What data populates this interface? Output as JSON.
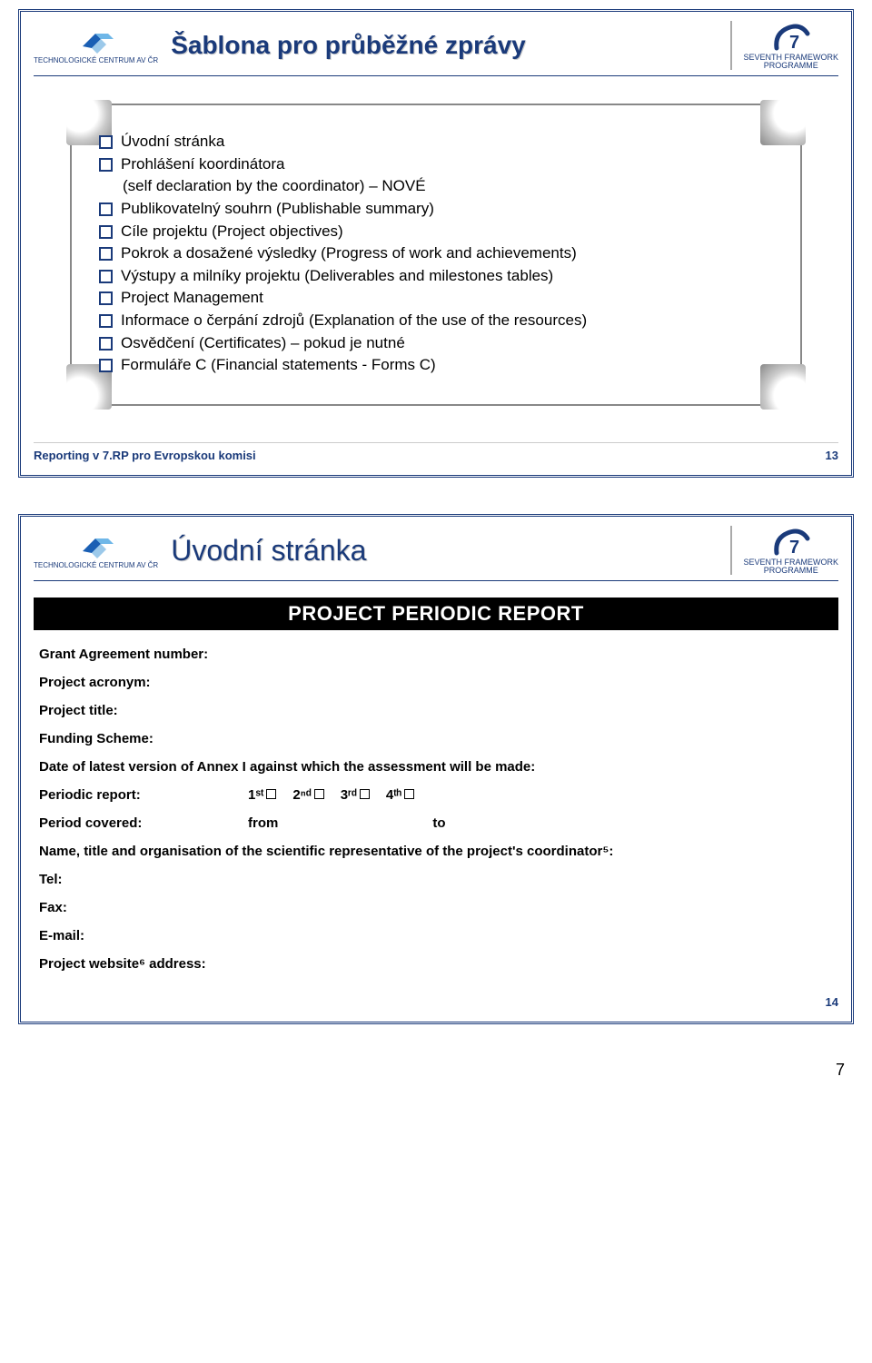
{
  "slide1": {
    "title": "Šablona pro průběžné zprávy",
    "logo_tc_line": "TECHNOLOGICKÉ CENTRUM AV ČR",
    "logo_fp7_line1": "SEVENTH FRAMEWORK",
    "logo_fp7_line2": "PROGRAMME",
    "bullets": [
      "Úvodní stránka",
      "Prohlášení koordinátora",
      "(self declaration by the coordinator) – NOVÉ",
      "Publikovatelný souhrn (Publishable summary)",
      "Cíle projektu (Project objectives)",
      "Pokrok a dosažené výsledky (Progress of work and achievements)",
      "Výstupy a milníky projektu (Deliverables and milestones tables)",
      "Project Management",
      "Informace o čerpání zdrojů (Explanation of the use of the resources)",
      "Osvědčení (Certificates) – pokud je nutné",
      "Formuláře C (Financial statements - Forms C)"
    ],
    "footer_left": "Reporting v 7.RP pro Evropskou komisi",
    "footer_right": "13"
  },
  "slide2": {
    "title": "Úvodní stránka",
    "black_bar": "PROJECT PERIODIC REPORT",
    "fields": {
      "grant_agreement": "Grant Agreement number:",
      "acronym": "Project acronym:",
      "title": "Project title:",
      "funding_scheme": "Funding Scheme:",
      "annex_date": "Date of latest version of Annex I against which the assessment will be made:",
      "periodic_report": "Periodic report:",
      "period_covered": "Period covered:",
      "from": "from",
      "to": "to",
      "ord1": "1ˢᵗ",
      "ord2": "2ⁿᵈ",
      "ord3": "3ʳᵈ",
      "ord4": "4ᵗʰ",
      "coord_name": "Name, title and organisation of the scientific representative of the project's coordinator⁵:",
      "tel": "Tel:",
      "fax": "Fax:",
      "email": "E-mail:",
      "website": "Project website⁶ address:"
    },
    "footer_right": "14"
  },
  "page_number": "7"
}
